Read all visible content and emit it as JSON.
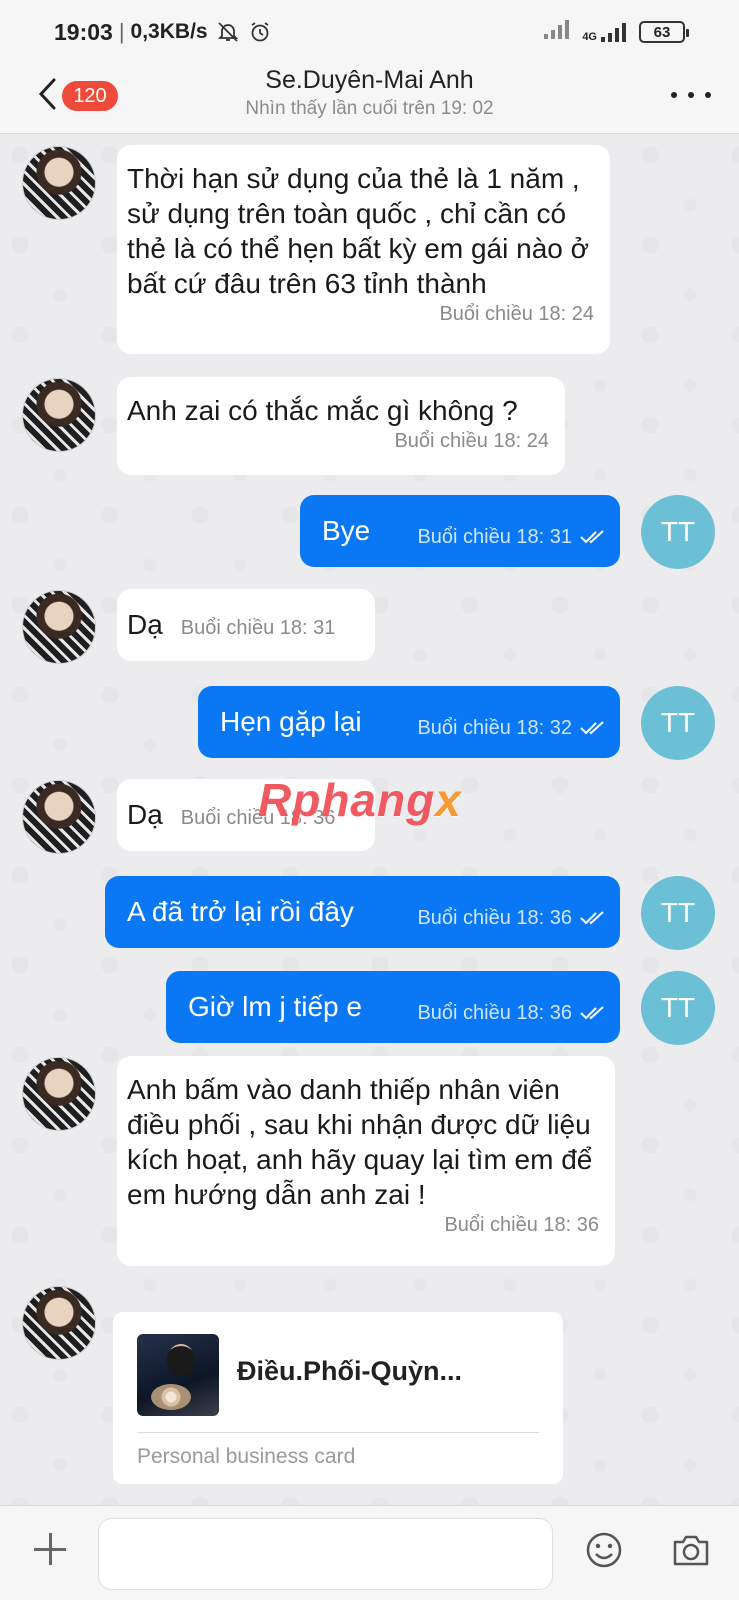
{
  "status": {
    "time": "19:03",
    "speed": "0,3KB/s",
    "network": "4G",
    "battery": "63"
  },
  "header": {
    "badge": "120",
    "title": "Se.Duyên-Mai Anh",
    "subtitle": "Nhìn thấy lần cuối trên 19: 02"
  },
  "messages": [
    {
      "text": "Thời hạn sử dụng của thẻ là 1 năm , sử dụng trên toàn quốc , chỉ cần có thẻ là có thể hẹn bất kỳ em gái nào ở bất cứ đâu trên 63 tỉnh thành",
      "time": "Buổi chiều  18: 24"
    },
    {
      "text": "Anh zai có thắc mắc gì không ?",
      "time": "Buổi chiều  18: 24"
    },
    {
      "text": "Bye",
      "time": "Buổi chiều  18: 31",
      "avatar": "TT"
    },
    {
      "text": "Dạ",
      "time": "Buổi chiều  18: 31"
    },
    {
      "text": "Hẹn gặp lại",
      "time": "Buổi chiều  18: 32",
      "avatar": "TT"
    },
    {
      "text": "Dạ",
      "time": "Buổi chiều  18: 36"
    },
    {
      "text": "A đã trở lại rồi đây",
      "time": "Buổi chiều  18: 36",
      "avatar": "TT"
    },
    {
      "text": "Giờ lm j tiếp e",
      "time": "Buổi chiều  18: 36",
      "avatar": "TT"
    },
    {
      "text": "Anh bấm vào danh thiếp nhân viên điều phối , sau khi nhận được dữ liệu kích hoạt, anh hãy quay lại tìm em để em hướng dẫn anh zai !",
      "time": "Buổi chiều  18: 36"
    }
  ],
  "card": {
    "name": "Điều.Phối-Quỳn...",
    "type": "Personal business card"
  },
  "watermark": {
    "main": "Rphang",
    "accent": "x"
  },
  "icons": [
    "back-icon",
    "more-icon",
    "plus-icon",
    "emoji-icon",
    "camera-icon",
    "double-check-icon"
  ],
  "colors": {
    "outgoing": "#0a78f5",
    "badge": "#f04b3a",
    "me_avatar": "#6cc0d6"
  }
}
